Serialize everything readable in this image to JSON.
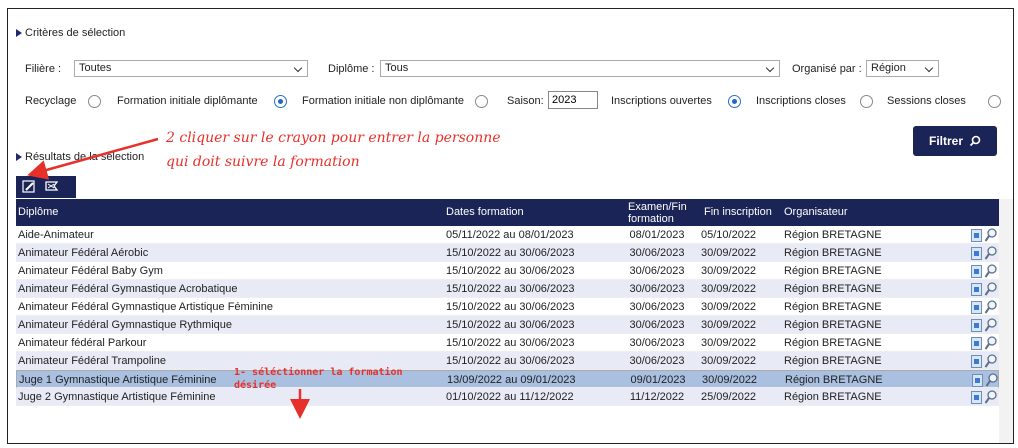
{
  "criteria": {
    "title": "Critères de sélection",
    "filiere_label": "Filière :",
    "filiere_value": "Toutes",
    "diplome_label": "Diplôme :",
    "diplome_value": "Tous",
    "organise_label": "Organisé par :",
    "organise_value": "Région",
    "recyclage": "Recyclage",
    "fid": "Formation initiale diplômante",
    "find": "Formation initiale non diplômante",
    "saison_label": "Saison:",
    "saison_value": "2023",
    "ouvertes": "Inscriptions ouvertes",
    "closes": "Inscriptions closes",
    "sessions": "Sessions closes",
    "filter_button": "Filtrer"
  },
  "results": {
    "title": "Résultats de la sélection"
  },
  "annotations": {
    "line1": "2 cliquer sur le crayon pour entrer la personne",
    "line2": "qui doit suivre la formation",
    "note1a": "1- séléctionner la formation",
    "note1b": "désirée"
  },
  "colors": {
    "header": "#1b2456",
    "annotation": "#e8302a",
    "selected_row": "#a9c0e1"
  },
  "icons": {
    "toolbar": [
      "edit-icon",
      "flag-icon"
    ],
    "row": [
      "document-icon",
      "magnifier-icon"
    ]
  },
  "table": {
    "headers": [
      "Diplôme",
      "Dates formation",
      "Examen/Fin",
      "formation",
      "Fin inscription",
      "Organisateur"
    ],
    "rows": [
      [
        "Aide-Animateur",
        "05/11/2022 au 08/01/2023",
        "08/01/2023",
        "05/10/2022",
        "Région BRETAGNE"
      ],
      [
        "Animateur Fédéral Aérobic",
        "15/10/2022 au 30/06/2023",
        "30/06/2023",
        "30/09/2022",
        "Région BRETAGNE"
      ],
      [
        "Animateur Fédéral Baby Gym",
        "15/10/2022 au 30/06/2023",
        "30/06/2023",
        "30/09/2022",
        "Région BRETAGNE"
      ],
      [
        "Animateur Fédéral Gymnastique Acrobatique",
        "15/10/2022 au 30/06/2023",
        "30/06/2023",
        "30/09/2022",
        "Région BRETAGNE"
      ],
      [
        "Animateur Fédéral Gymnastique Artistique Féminine",
        "15/10/2022 au 30/06/2023",
        "30/06/2023",
        "30/09/2022",
        "Région BRETAGNE"
      ],
      [
        "Animateur Fédéral Gymnastique Rythmique",
        "15/10/2022 au 30/06/2023",
        "30/06/2023",
        "30/09/2022",
        "Région BRETAGNE"
      ],
      [
        "Animateur fédéral Parkour",
        "15/10/2022 au 30/06/2023",
        "30/06/2023",
        "30/09/2022",
        "Région BRETAGNE"
      ],
      [
        "Animateur Fédéral Trampoline",
        "15/10/2022 au 30/06/2023",
        "30/06/2023",
        "30/09/2022",
        "Région BRETAGNE"
      ],
      [
        "Juge 1 Gymnastique Artistique Féminine",
        "13/09/2022 au 09/01/2023",
        "09/01/2023",
        "30/09/2022",
        "Région BRETAGNE"
      ],
      [
        "Juge 2 Gymnastique Artistique Féminine",
        "01/10/2022 au 11/12/2022",
        "11/12/2022",
        "25/09/2022",
        "Région BRETAGNE"
      ]
    ]
  }
}
